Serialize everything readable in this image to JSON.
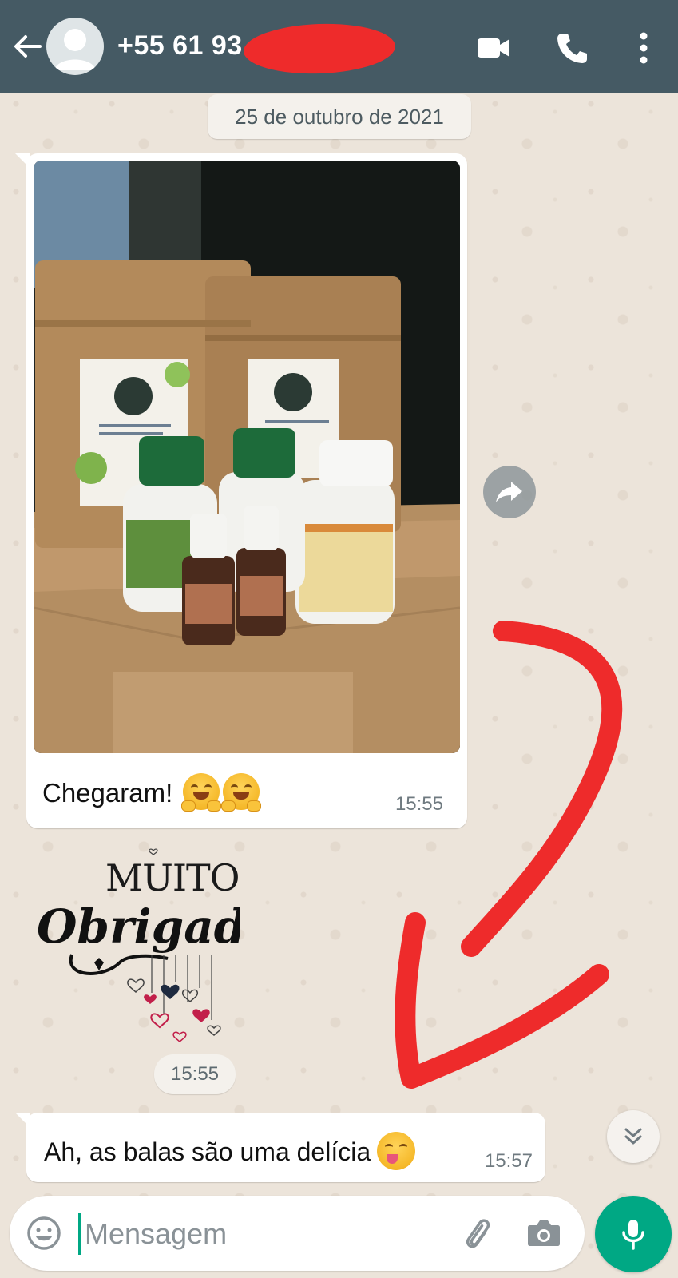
{
  "header": {
    "contact_name": "+55 61 93",
    "bg_color": "#455a64",
    "icons": [
      "arrow-back-icon",
      "avatar-icon",
      "video-call-icon",
      "phone-icon",
      "more-vertical-icon"
    ]
  },
  "chat": {
    "date_chip": "25 de outubro de 2021",
    "messages": [
      {
        "type": "image",
        "caption": "Chegaram!",
        "emojis": [
          "hugging-face-emoji",
          "hugging-face-emoji"
        ],
        "time": "15:55"
      },
      {
        "type": "sticker",
        "sticker_text_top": "MUITO",
        "sticker_text_main": "Obrigada",
        "time": "15:55"
      },
      {
        "type": "text",
        "text": "Ah, as balas são uma delícia",
        "emojis": [
          "yum-face-emoji"
        ],
        "time": "15:57"
      }
    ]
  },
  "composer": {
    "placeholder": "Mensagem",
    "value": "",
    "accent_color": "#00a884",
    "icons": [
      "emoji-icon",
      "attach-icon",
      "camera-icon",
      "mic-icon"
    ]
  },
  "annotation": {
    "arrow_color": "#ee2b2b"
  }
}
